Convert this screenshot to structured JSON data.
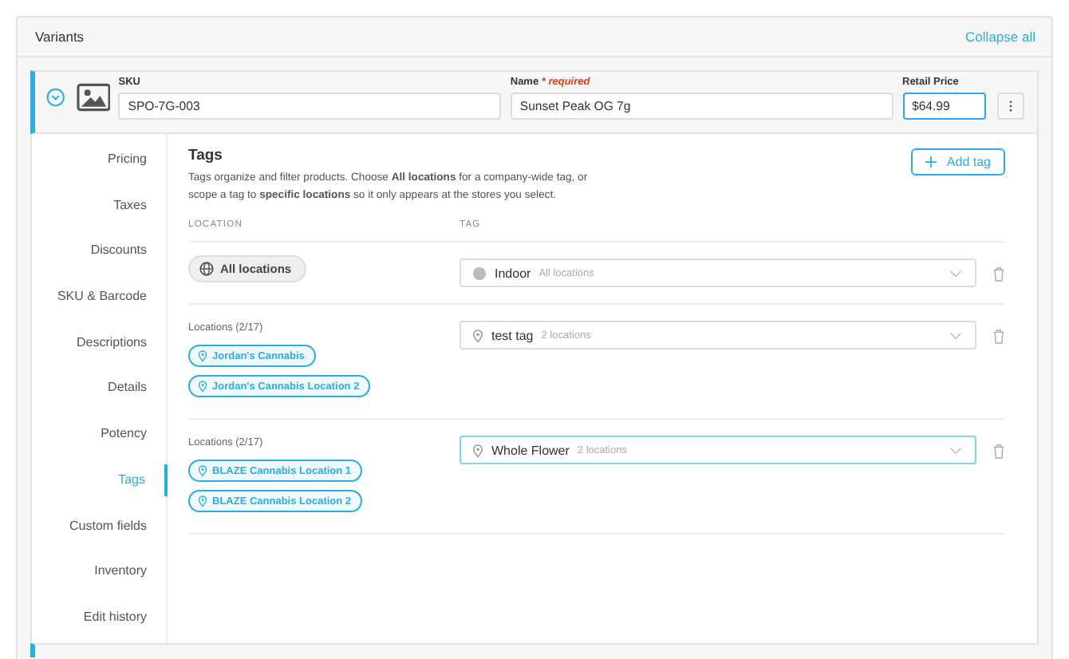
{
  "panel": {
    "title": "Variants",
    "collapse_link": "Collapse all"
  },
  "variant": {
    "expanded": true,
    "sku_label": "SKU",
    "sku": "SPO-7G-003",
    "name_label": "Name",
    "name_required": "* required",
    "name": "Sunset Peak OG 7g",
    "price_label": "Retail Price",
    "price": "$64.99"
  },
  "nav": [
    {
      "label": "Pricing",
      "selected": false
    },
    {
      "label": "Taxes",
      "selected": false
    },
    {
      "label": "Discounts",
      "selected": false
    },
    {
      "label": "SKU & Barcode",
      "selected": false
    },
    {
      "label": "Descriptions",
      "selected": false
    },
    {
      "label": "Details",
      "selected": false
    },
    {
      "label": "Potency",
      "selected": false
    },
    {
      "label": "Tags",
      "selected": true
    },
    {
      "label": "Custom fields",
      "selected": false
    },
    {
      "label": "Inventory",
      "selected": false
    },
    {
      "label": "Edit history",
      "selected": false
    }
  ],
  "tags": {
    "title": "Tags",
    "description": "Tags organize and filter products. Choose **All locations** for a company-wide tag, or scope a tag to **specific locations** so it only appears at the stores you select.",
    "add_button": "Add tag",
    "columns": [
      "LOCATION",
      "TAG"
    ],
    "rows": [
      {
        "kind": "global",
        "scope_label": "All locations",
        "locations": [],
        "tag": "Indoor",
        "tag_scope": "All locations",
        "focused": false
      },
      {
        "kind": "locations",
        "scope_label": "Locations (2/17)",
        "locations": [
          "Jordan's Cannabis",
          "Jordan's Cannabis Location 2"
        ],
        "tag": "test tag",
        "tag_scope": "2 locations",
        "focused": false
      },
      {
        "kind": "locations",
        "scope_label": "Locations (2/17)",
        "locations": [
          "BLAZE Cannabis Location 1",
          "BLAZE Cannabis Location 2"
        ],
        "tag": "Whole Flower",
        "tag_scope": "2 locations",
        "focused": true
      }
    ]
  }
}
